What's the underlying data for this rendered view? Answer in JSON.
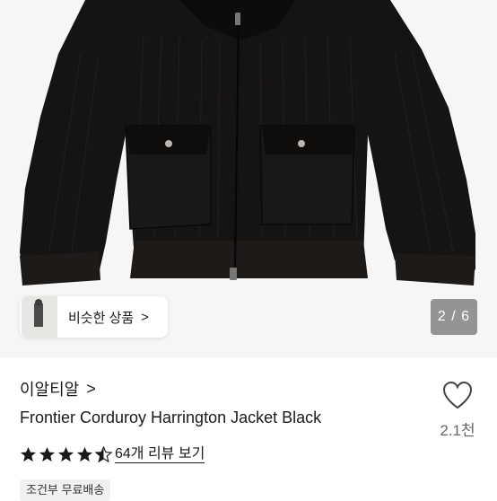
{
  "gallery": {
    "similar_label": "비슷한 상품",
    "similar_chevron": ">",
    "counter": "2 / 6"
  },
  "product": {
    "store_name": "이알티알",
    "store_chevron": ">",
    "title": "Frontier Corduroy Harrington Jacket Black",
    "likes": "2.1천",
    "rating": 4.5,
    "review_link": "64개 리뷰 보기",
    "shipping_badge": "조건부 무료배송"
  },
  "colors": {
    "star": "#1a1a1a",
    "jacket": "#151310"
  },
  "icons": {
    "like": "heart-outline-icon",
    "rating": "star-icon"
  }
}
